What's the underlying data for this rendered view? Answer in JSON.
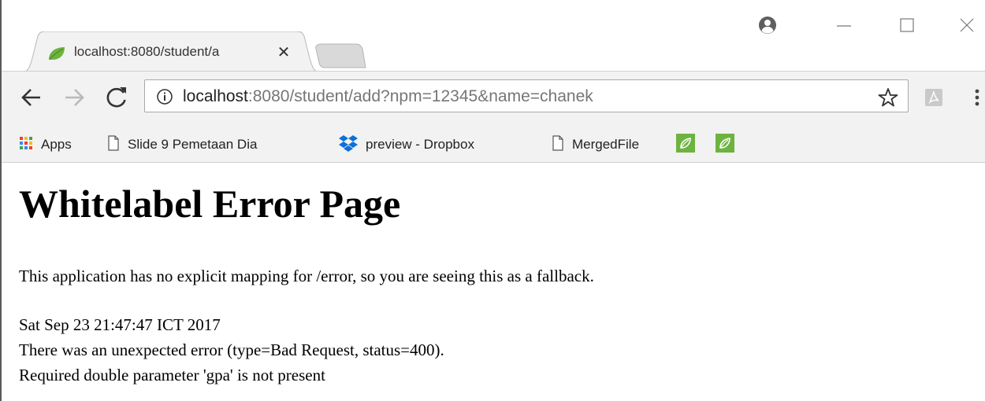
{
  "tab": {
    "title": "localhost:8080/student/a",
    "close_glyph": "✕"
  },
  "window_controls": {
    "minimize": "—",
    "maximize": "☐",
    "close": "✕"
  },
  "address_bar": {
    "host": "localhost",
    "rest": ":8080/student/add?npm=12345&name=chanek"
  },
  "bookmarks": [
    {
      "label": "Apps",
      "icon": "apps-grid-icon"
    },
    {
      "label": "Slide 9 Pemetaan Dia",
      "icon": "page-icon"
    },
    {
      "label": "preview - Dropbox",
      "icon": "dropbox-icon"
    },
    {
      "label": "MergedFile",
      "icon": "page-icon"
    },
    {
      "label": "",
      "icon": "leaf-icon"
    },
    {
      "label": "",
      "icon": "leaf-icon"
    }
  ],
  "page": {
    "heading": "Whitelabel Error Page",
    "message": "This application has no explicit mapping for /error, so you are seeing this as a fallback.",
    "timestamp": "Sat Sep 23 21:47:47 ICT 2017",
    "error_line": "There was an unexpected error (type=Bad Request, status=400).",
    "detail": "Required double parameter 'gpa' is not present"
  },
  "colors": {
    "toolbar_bg": "#f2f2f2",
    "spring_green": "#6db33f",
    "dropbox_blue": "#0d6fd8"
  }
}
